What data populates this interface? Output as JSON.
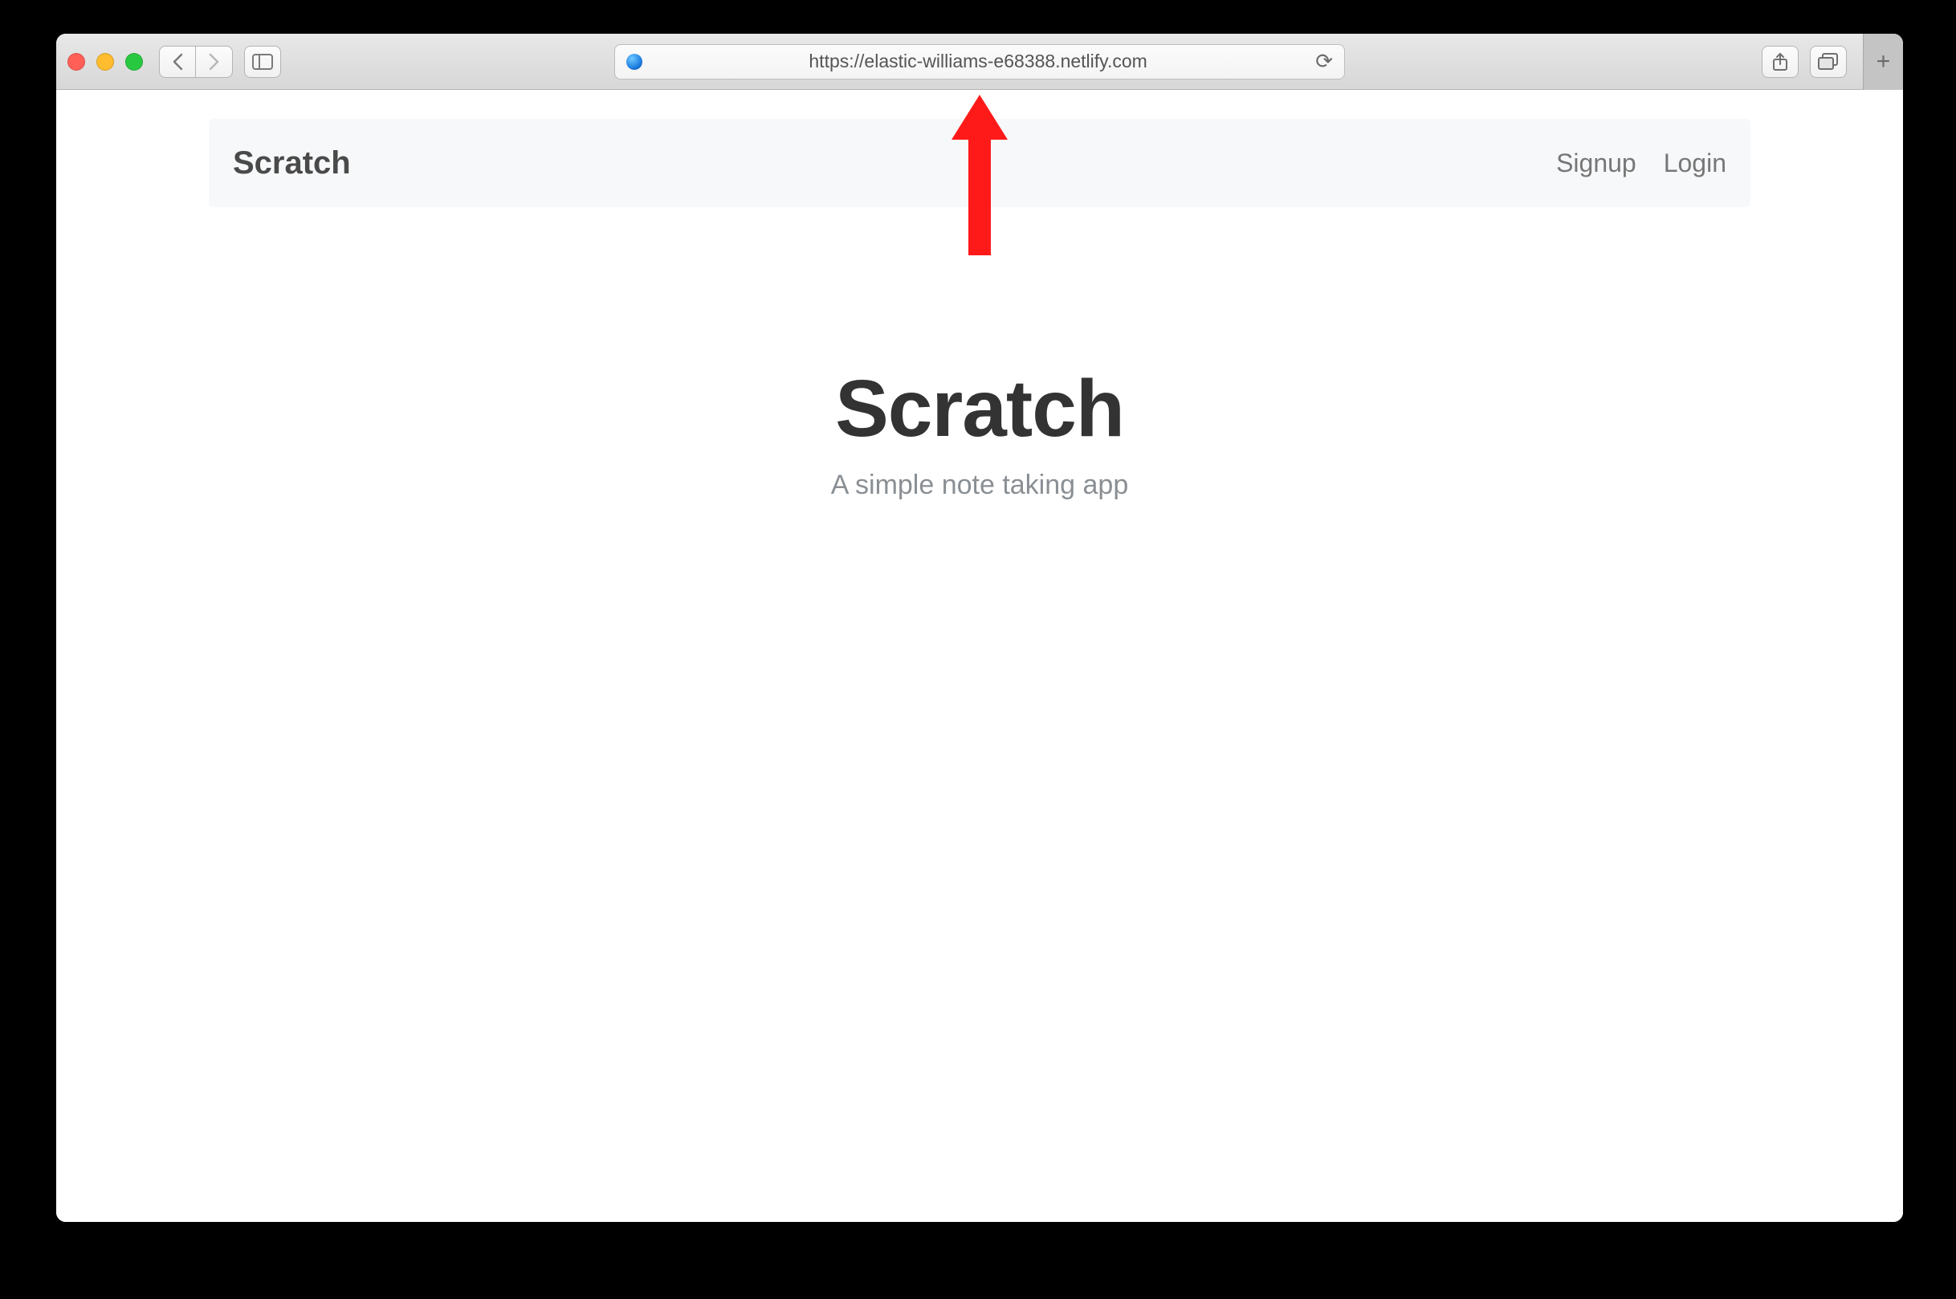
{
  "browser": {
    "url": "https://elastic-williams-e68388.netlify.com"
  },
  "navbar": {
    "brand": "Scratch",
    "links": {
      "signup": "Signup",
      "login": "Login"
    }
  },
  "hero": {
    "title": "Scratch",
    "subtitle": "A simple note taking app"
  }
}
